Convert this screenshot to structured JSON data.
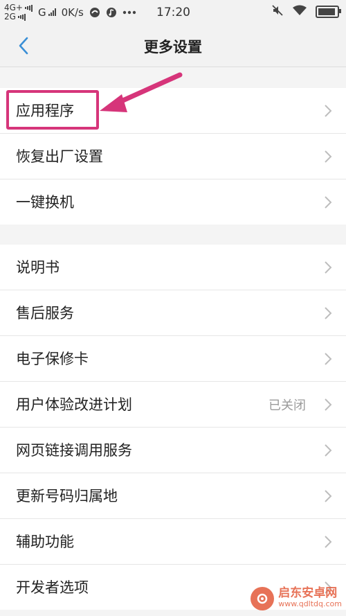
{
  "status_bar": {
    "net1": "4G+",
    "net2": "2G",
    "carrier2": "G",
    "speed": "0K/s",
    "time": "17:20"
  },
  "header": {
    "title": "更多设置"
  },
  "group1": [
    {
      "label": "应用程序"
    },
    {
      "label": "恢复出厂设置"
    },
    {
      "label": "一键换机"
    }
  ],
  "group2": [
    {
      "label": "说明书"
    },
    {
      "label": "售后服务"
    },
    {
      "label": "电子保修卡"
    },
    {
      "label": "用户体验改进计划",
      "value": "已关闭"
    },
    {
      "label": "网页链接调用服务"
    },
    {
      "label": "更新号码归属地"
    },
    {
      "label": "辅助功能"
    },
    {
      "label": "开发者选项"
    }
  ],
  "watermark": {
    "name": "启东安卓网",
    "url": "www.qdltdq.com"
  },
  "colors": {
    "accent": "#3a8fd6",
    "annotation": "#d6357a",
    "watermark": "#e35a3a"
  }
}
